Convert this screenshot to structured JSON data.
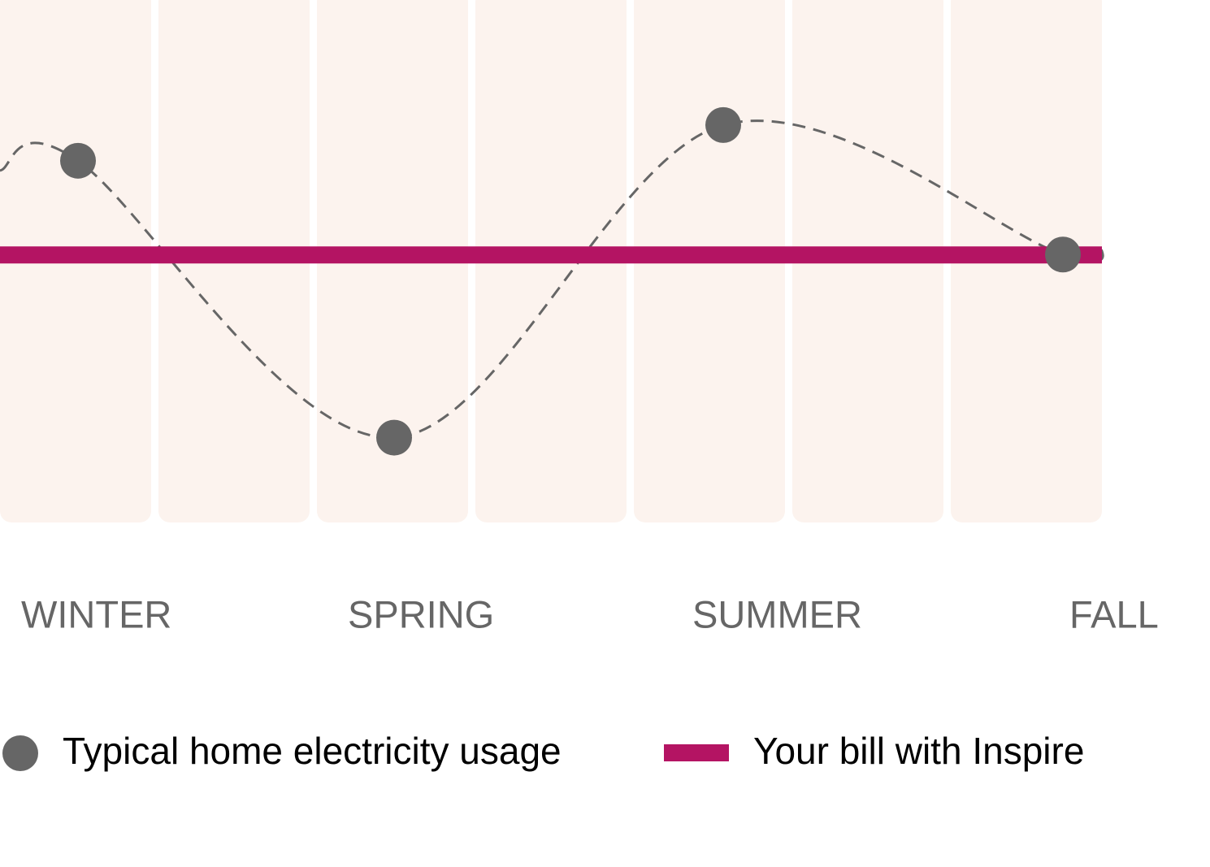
{
  "chart_data": {
    "type": "line",
    "title": "",
    "xlabel": "",
    "ylabel": "",
    "categories": [
      "WINTER",
      "SPRING",
      "SUMMER",
      "FALL"
    ],
    "grid": false,
    "series": [
      {
        "name": "Typical home electricity usage",
        "style": "dashed-smooth-line-with-points",
        "values": [
          81,
          19,
          89,
          60
        ]
      },
      {
        "name": "Your bill with Inspire",
        "style": "flat-line",
        "values": [
          60,
          60,
          60,
          60
        ]
      }
    ],
    "ylim": [
      0,
      117
    ],
    "legend": {
      "position": "bottom-left",
      "items": [
        {
          "label": "Typical home electricity usage",
          "marker": "circle"
        },
        {
          "label": "Your bill with Inspire",
          "marker": "bar"
        }
      ]
    }
  },
  "colors": {
    "usage": "#666666",
    "inspire": "#b41463",
    "column_background": "#fcf3ee",
    "label_text": "#666666",
    "legend_text": "#000000"
  }
}
